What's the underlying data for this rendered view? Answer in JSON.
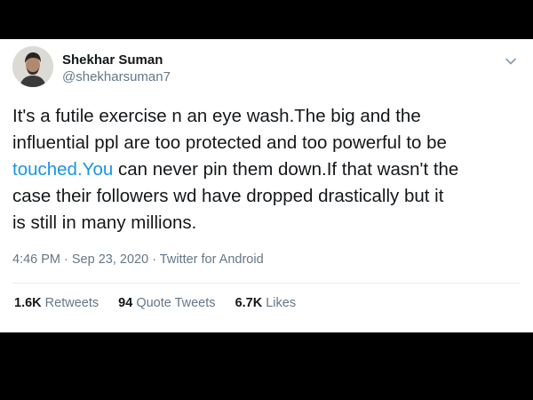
{
  "author": {
    "display_name": "Shekhar Suman",
    "handle": "@shekharsuman7"
  },
  "tweet": {
    "text_before": "It's a futile exercise n an eye wash.The big and the\ninfluential ppl are too protected and too powerful to be\n",
    "link_text": "touched.You",
    "text_after": " can never pin them down.If that wasn't the\ncase their followers wd have dropped drastically but it\nis still in many millions."
  },
  "meta": {
    "time": "4:46 PM",
    "separator1": " · ",
    "date": "Sep 23, 2020",
    "separator2": " · ",
    "source": "Twitter for Android"
  },
  "stats": {
    "retweets_count": "1.6K",
    "retweets_label": "Retweets",
    "quotes_count": "94",
    "quotes_label": "Quote Tweets",
    "likes_count": "6.7K",
    "likes_label": "Likes"
  },
  "icons": {
    "caret": "chevron-down-icon"
  },
  "colors": {
    "link": "#1b95e0",
    "secondary_text": "#657786",
    "primary_text": "#14171a",
    "letterbox": "#000000"
  }
}
